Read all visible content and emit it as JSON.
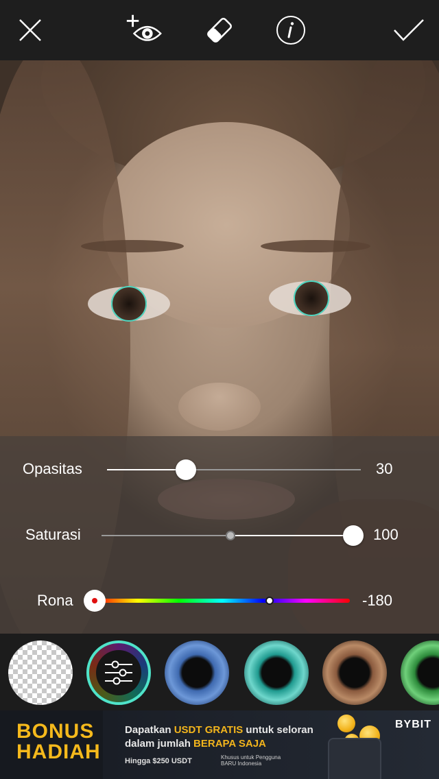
{
  "toolbar": {
    "close_icon": "close-icon",
    "add_eye_icon": "add-eye-icon",
    "eraser_icon": "eraser-icon",
    "info_icon": "info-icon",
    "apply_icon": "checkmark-icon"
  },
  "sliders": {
    "opacity": {
      "label": "Opasitas",
      "value": "30",
      "fraction": 0.3
    },
    "saturation": {
      "label": "Saturasi",
      "value": "100",
      "fraction": 1.0
    },
    "hue": {
      "label": "Rona",
      "value": "-180",
      "fraction": 0.0
    }
  },
  "lenses": [
    "none",
    "adjust",
    "blue",
    "teal",
    "brown",
    "green"
  ],
  "ad": {
    "bonus_line1": "BONUS",
    "bonus_line2": "HADIAH",
    "text_part1": "Dapatkan ",
    "text_hl1": "USDT GRATIS",
    "text_part2": " untuk seloran",
    "text_part3": "dalam jumlah ",
    "text_hl2": "BERAPA SAJA",
    "small": "Hingga $250 USDT",
    "tiny": "Khusus untuk Pengguna BARU Indonesia",
    "brand": "BYBIT"
  },
  "colors": {
    "accent": "#4fe3c9",
    "toolbar_bg": "#1e1e1e",
    "ad_highlight": "#f3b51c"
  }
}
